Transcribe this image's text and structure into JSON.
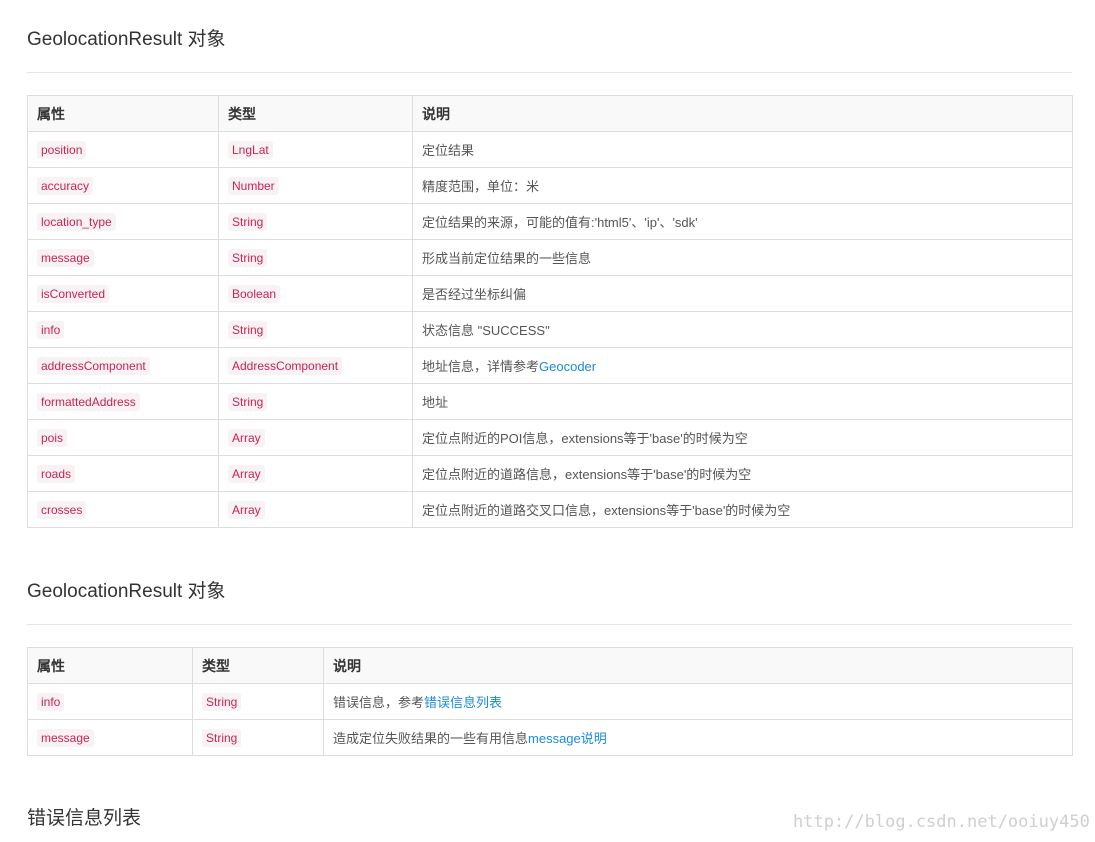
{
  "section1": {
    "title": "GeolocationResult 对象",
    "headers": [
      "属性",
      "类型",
      "说明"
    ],
    "rows": [
      {
        "attr": "position",
        "type": "LngLat",
        "desc": "定位结果"
      },
      {
        "attr": "accuracy",
        "type": "Number",
        "desc": "精度范围，单位：米"
      },
      {
        "attr": "location_type",
        "type": "String",
        "desc": "定位结果的来源，可能的值有:'html5'、'ip'、'sdk'"
      },
      {
        "attr": "message",
        "type": "String",
        "desc": "形成当前定位结果的一些信息"
      },
      {
        "attr": "isConverted",
        "type": "Boolean",
        "desc": "是否经过坐标纠偏"
      },
      {
        "attr": "info",
        "type": "String",
        "desc": "状态信息 \"SUCCESS\""
      },
      {
        "attr": "addressComponent",
        "type": "AddressComponent",
        "desc": "地址信息，详情参考",
        "link": "Geocoder"
      },
      {
        "attr": "formattedAddress",
        "type": "String",
        "desc": "地址"
      },
      {
        "attr": "pois",
        "type": "Array",
        "desc": "定位点附近的POI信息，extensions等于'base'的时候为空"
      },
      {
        "attr": "roads",
        "type": "Array",
        "desc": "定位点附近的道路信息，extensions等于'base'的时候为空"
      },
      {
        "attr": "crosses",
        "type": "Array",
        "desc": "定位点附近的道路交叉口信息，extensions等于'base'的时候为空"
      }
    ]
  },
  "section2": {
    "title": "GeolocationResult 对象",
    "headers": [
      "属性",
      "类型",
      "说明"
    ],
    "rows": [
      {
        "attr": "info",
        "type": "String",
        "desc": "错误信息，参考",
        "link": "错误信息列表"
      },
      {
        "attr": "message",
        "type": "String",
        "desc": "造成定位失败结果的一些有用信息",
        "link": "message说明"
      }
    ]
  },
  "section3": {
    "title": "错误信息列表"
  },
  "watermark": "http://blog.csdn.net/ooiuy450",
  "colors": {
    "code_text": "#c7254e",
    "code_bg": "#f9f2f4",
    "link": "#1a8ae3",
    "border": "#dddddd",
    "header_bg": "#f9f9f9"
  }
}
